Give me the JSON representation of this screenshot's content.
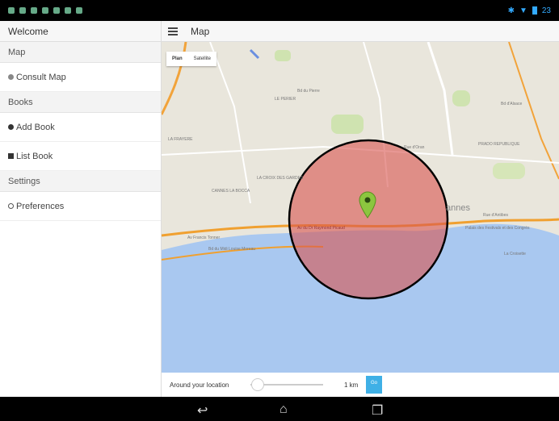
{
  "statusbar": {
    "time": "23"
  },
  "drawer": {
    "header": "Welcome",
    "sections": [
      {
        "title": "Map",
        "items": [
          {
            "label": "Consult Map",
            "icon": "globe-icon"
          }
        ]
      },
      {
        "title": "Books",
        "items": [
          {
            "label": "Add Book",
            "icon": "plus-circle-icon"
          },
          {
            "label": "List Book",
            "icon": "list-icon"
          }
        ]
      },
      {
        "title": "Settings",
        "items": [
          {
            "label": "Preferences",
            "icon": "ring-icon"
          }
        ]
      }
    ]
  },
  "topbar": {
    "title": "Map"
  },
  "map": {
    "type_buttons": [
      "Plan",
      "Satellite"
    ],
    "labels": [
      "Bd du Pierre",
      "LE PERIER",
      "LA FRAYERE",
      "LA CROIX DES GARDES",
      "CANNES LA BOCCA",
      "Av Francis Tonner",
      "Bd du Midi Louise Moreau",
      "Av du Dr Raymond Picaud",
      "annes",
      "Rue d'Antibes",
      "Palais des Festivals et des Congrès",
      "La Croisette",
      "PRADO REPUBLIQUE",
      "Bd d'Alsace",
      "Rue d'Oran"
    ],
    "circle_color": "#d9534f",
    "marker_color": "#8cc63f"
  },
  "controls": {
    "label": "Around your location",
    "distance": "1 km",
    "go_label": "Go",
    "slider_fraction": 0.05
  }
}
